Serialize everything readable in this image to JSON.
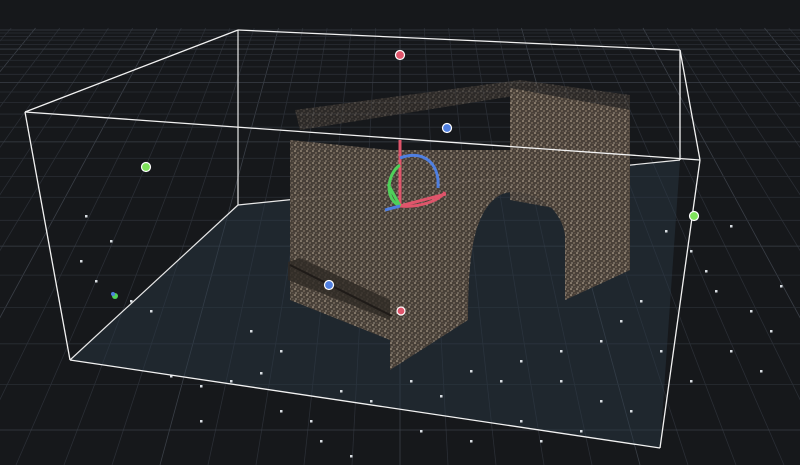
{
  "viewport": {
    "background": "#16181b",
    "grid_color": "#3a3f47",
    "grid_minor_color": "#2a2e35",
    "box_color": "#f2f2f2",
    "floor_tint": "#1f2a33"
  },
  "gizmo": {
    "axes": [
      {
        "name": "x-axis",
        "color": "#e0556b"
      },
      {
        "name": "y-axis",
        "color": "#4fd05a"
      },
      {
        "name": "z-axis",
        "color": "#4f7fe0"
      }
    ]
  },
  "handles": [
    {
      "name": "top-handle",
      "color": "#e0556b"
    },
    {
      "name": "back-handle",
      "color": "#4f7fe0"
    },
    {
      "name": "left-handle",
      "color": "#7ee35b"
    },
    {
      "name": "right-handle",
      "color": "#7ee35b"
    },
    {
      "name": "front-handle",
      "color": "#4f7fe0"
    },
    {
      "name": "bottom-handle",
      "color": "#e0556b"
    }
  ]
}
